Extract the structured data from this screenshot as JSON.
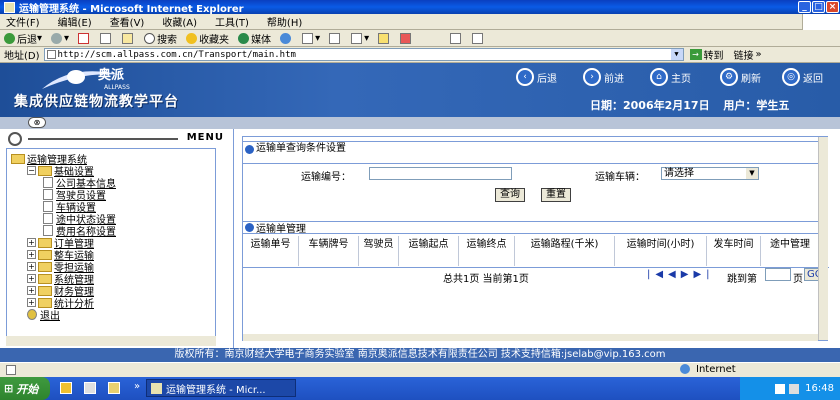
{
  "window": {
    "title": "运输管理系统 - Microsoft Internet Explorer"
  },
  "menubar": {
    "items": [
      "文件(F)",
      "编辑(E)",
      "查看(V)",
      "收藏(A)",
      "工具(T)",
      "帮助(H)"
    ]
  },
  "toolbar": {
    "back": "后退",
    "search": "搜索",
    "favorites": "收藏夹",
    "media": "媒体"
  },
  "address": {
    "label": "地址(D)",
    "url": "http://scm.allpass.com.cn/Transport/main.htm",
    "go": "转到",
    "links": "链接"
  },
  "banner": {
    "logo_text": "奥派",
    "logo_sub": "ALLPASS",
    "platform": "集成供应链物流教学平台",
    "nav": [
      "后退",
      "前进",
      "主页",
      "刷新",
      "返回"
    ],
    "date_label": "日期：",
    "date": "2006年2月17日",
    "user_label": "用户：",
    "user": "学生五"
  },
  "menu": {
    "title": "MENU",
    "tree": [
      {
        "label": "运输管理系统",
        "level": 0,
        "type": "folder",
        "toggle": ""
      },
      {
        "label": "基础设置",
        "level": 1,
        "type": "folder",
        "toggle": "−"
      },
      {
        "label": "公司基本信息",
        "level": 2,
        "type": "doc"
      },
      {
        "label": "驾驶员设置",
        "level": 2,
        "type": "doc"
      },
      {
        "label": "车辆设置",
        "level": 2,
        "type": "doc"
      },
      {
        "label": "途中状态设置",
        "level": 2,
        "type": "doc"
      },
      {
        "label": "费用名称设置",
        "level": 2,
        "type": "doc"
      },
      {
        "label": "订单管理",
        "level": 1,
        "type": "folder",
        "toggle": "+"
      },
      {
        "label": "整车运输",
        "level": 1,
        "type": "folder",
        "toggle": "+"
      },
      {
        "label": "零担运输",
        "level": 1,
        "type": "folder",
        "toggle": "+"
      },
      {
        "label": "系统管理",
        "level": 1,
        "type": "folder",
        "toggle": "+"
      },
      {
        "label": "财务管理",
        "level": 1,
        "type": "folder",
        "toggle": "+"
      },
      {
        "label": "统计分析",
        "level": 1,
        "type": "folder",
        "toggle": "+"
      },
      {
        "label": "退出",
        "level": 1,
        "type": "exit"
      }
    ]
  },
  "query": {
    "title": "运输单查询条件设置",
    "order_no_label": "运输编号：",
    "order_no_value": "",
    "vehicle_label": "运输车辆：",
    "vehicle_value": "请选择",
    "search_btn": "查询",
    "reset_btn": "重置"
  },
  "manage": {
    "title": "运输单管理",
    "columns": [
      "运输单号",
      "车辆牌号",
      "驾驶员",
      "运输起点",
      "运输终点",
      "运输路程(千米)",
      "运输时间(小时)",
      "发车时间",
      "途中管理"
    ],
    "pager": {
      "summary": "总共1页 当前第1页",
      "jump_label": "跳到第",
      "page_unit": "页",
      "go": "GO"
    }
  },
  "footer": "版权所有：南京财经大学电子商务实验室 南京奥派信息技术有限责任公司 技术支持信箱:jselab@vip.163.com",
  "statusbar": {
    "zone": "Internet"
  },
  "taskbar": {
    "start": "开始",
    "task": "运输管理系统 - Micr...",
    "time": "16:48"
  }
}
